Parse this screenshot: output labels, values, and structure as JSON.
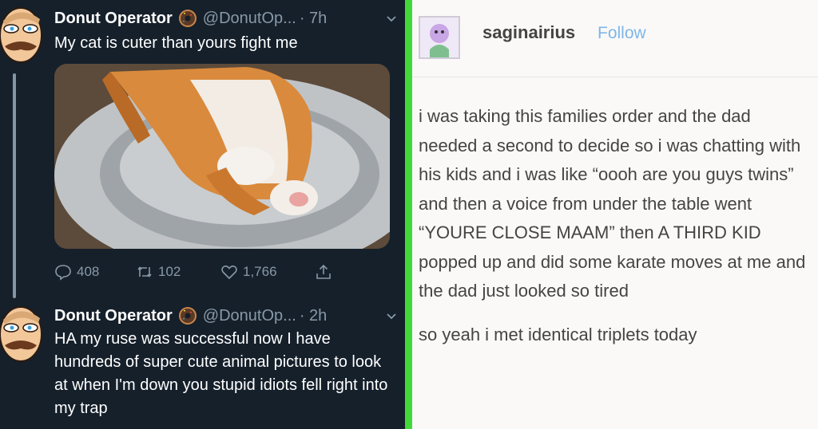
{
  "tweets": [
    {
      "name": "Donut Operator",
      "handle": "@DonutOp...",
      "time": "· 7h",
      "text": "My cat is cuter than yours fight me",
      "image_desc": "cat-photo",
      "stats": {
        "replies": "408",
        "retweets": "102",
        "likes": "1,766"
      }
    },
    {
      "name": "Donut Operator",
      "handle": "@DonutOp...",
      "time": "· 2h",
      "text": "HA my ruse was successful now I have hundreds of super cute animal pictures to look at when I'm down you stupid idiots fell right into my trap"
    }
  ],
  "tumblr": {
    "username": "saginairius",
    "follow_label": "Follow",
    "paragraphs": [
      "i was taking this families order and the dad needed a second to decide so i was chatting with his kids and i was like “oooh are you guys twins” and then a voice from under the table went “YOURE CLOSE MAAM” then A THIRD KID popped up and did some karate moves at me and the dad just looked so tired",
      "so yeah i met identical triplets today"
    ]
  },
  "colors": {
    "twitter_bg": "#15202b",
    "twitter_muted": "#8899a6",
    "divider_green": "#43d83a",
    "tumblr_bg": "#fbf9f8",
    "tumblr_text": "#444444",
    "follow_blue": "#7db6e8"
  }
}
